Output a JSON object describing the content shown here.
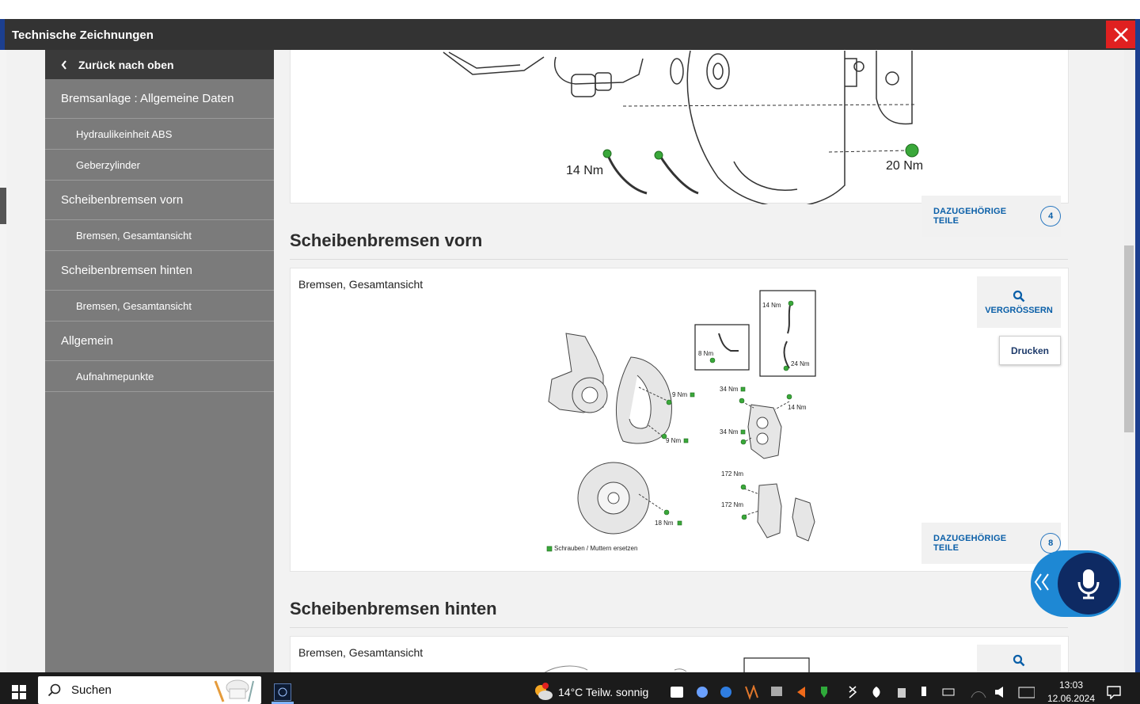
{
  "window": {
    "title": "Technische Zeichnungen",
    "accent": "#e02020"
  },
  "sidebar": {
    "back_label": "Zurück nach oben",
    "items": [
      {
        "label": "Bremsanlage : Allgemeine Daten",
        "level": 1
      },
      {
        "label": "Hydraulikeinheit ABS",
        "level": 2
      },
      {
        "label": "Geberzylinder",
        "level": 2
      },
      {
        "label": "Scheibenbremsen vorn",
        "level": 1
      },
      {
        "label": "Bremsen, Gesamtansicht",
        "level": 2
      },
      {
        "label": "Scheibenbremsen hinten",
        "level": 1
      },
      {
        "label": "Bremsen, Gesamtansicht",
        "level": 2
      },
      {
        "label": "Allgemein",
        "level": 1
      },
      {
        "label": "Aufnahmepunkte",
        "level": 2
      }
    ]
  },
  "main": {
    "top_card": {
      "torque_labels": [
        "14 Nm",
        "20 Nm"
      ],
      "related_label": "DAZUGEHÖRIGE TEILE",
      "related_count": "4"
    },
    "sections": [
      {
        "heading": "Scheibenbremsen vorn",
        "card_title": "Bremsen, Gesamtansicht",
        "zoom_label": "VERGRÖSSERN",
        "print_label": "Drucken",
        "related_label": "DAZUGEHÖRIGE TEILE",
        "related_count": "8",
        "drawing_labels": [
          "14 Nm",
          "8 Nm",
          "24 Nm",
          "9 Nm",
          "34 Nm",
          "14 Nm",
          "34 Nm",
          "9 Nm",
          "172 Nm",
          "172 Nm",
          "18 Nm"
        ],
        "legend": "Schrauben / Muttern ersetzen"
      },
      {
        "heading": "Scheibenbremsen hinten",
        "card_title": "Bremsen, Gesamtansicht"
      }
    ]
  },
  "taskbar": {
    "search_placeholder": "Suchen",
    "weather": "14°C  Teilw. sonnig",
    "time": "13:03",
    "date": "12.06.2024"
  }
}
